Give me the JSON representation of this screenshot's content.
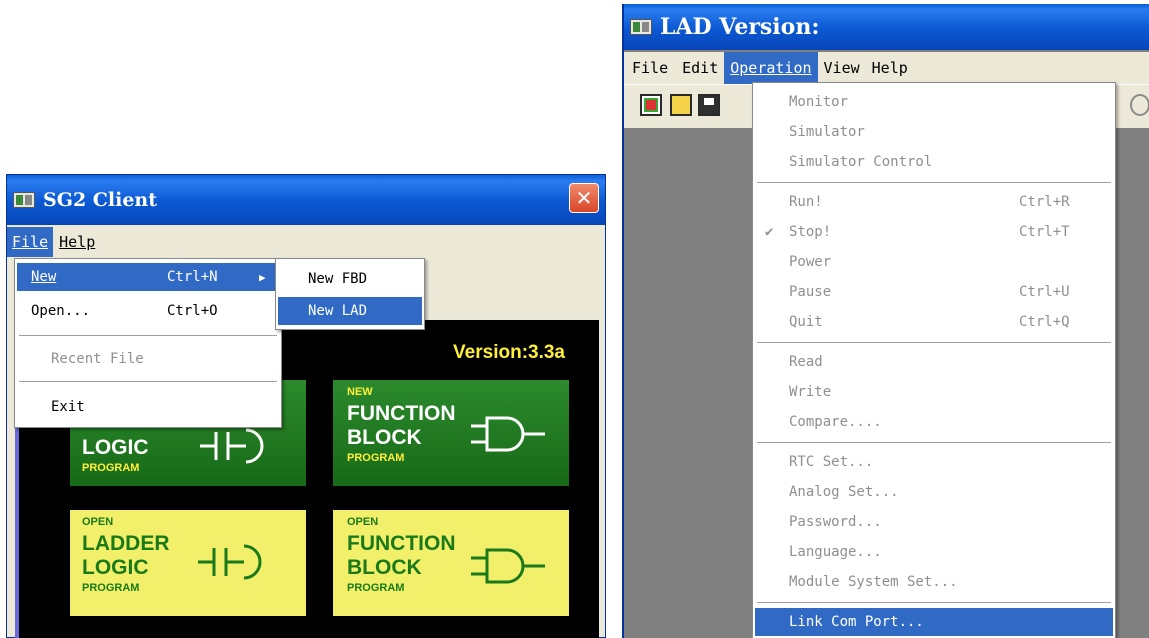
{
  "left_window": {
    "title": "SG2 Client",
    "menu": [
      {
        "label": "File",
        "key": "F"
      },
      {
        "label": "Help",
        "key": "H"
      }
    ],
    "file_menu": [
      {
        "label": "New",
        "shortcut": "Ctrl+N",
        "submenu": true,
        "state": "highlighted"
      },
      {
        "label": "Open...",
        "shortcut": "Ctrl+O",
        "state": "enabled"
      },
      {
        "label": "Recent File",
        "shortcut": "",
        "state": "disabled"
      },
      {
        "label": "Exit",
        "shortcut": "",
        "state": "enabled"
      }
    ],
    "new_submenu": [
      {
        "label": "New FBD",
        "state": "enabled"
      },
      {
        "label": "New LAD",
        "state": "highlighted"
      }
    ],
    "version": "Version:3.3a",
    "tiles": {
      "new_ladder": {
        "big": [
          "LOGIC"
        ],
        "small": "PROGRAM"
      },
      "new_fbd": {
        "top": "NEW",
        "big": [
          "FUNCTION",
          "BLOCK"
        ],
        "small": "PROGRAM"
      },
      "open_ladder": {
        "top": "OPEN",
        "big": [
          "LADDER",
          "LOGIC"
        ],
        "small": "PROGRAM"
      },
      "open_fbd": {
        "top": "OPEN",
        "big": [
          "FUNCTION",
          "BLOCK"
        ],
        "small": "PROGRAM"
      }
    }
  },
  "right_window": {
    "title": "LAD Version:",
    "menu": [
      {
        "label": "File",
        "key": "F",
        "state": "normal"
      },
      {
        "label": "Edit",
        "key": "E",
        "state": "normal"
      },
      {
        "label": "Operation",
        "key": "O",
        "state": "open"
      },
      {
        "label": "View",
        "key": "V",
        "state": "normal"
      },
      {
        "label": "Help",
        "key": "H",
        "state": "normal"
      }
    ],
    "toolbar_icons": [
      "new-icon",
      "open-folder-icon",
      "save-icon"
    ],
    "operation_menu": [
      {
        "label": "Monitor",
        "shortcut": "",
        "state": "disabled",
        "checked": false
      },
      {
        "label": "Simulator",
        "shortcut": "",
        "state": "disabled",
        "checked": false
      },
      {
        "label": "Simulator Control",
        "shortcut": "",
        "state": "disabled",
        "checked": false
      },
      {
        "label": "Run!",
        "shortcut": "Ctrl+R",
        "state": "disabled",
        "checked": false
      },
      {
        "label": "Stop!",
        "shortcut": "Ctrl+T",
        "state": "disabled",
        "checked": true
      },
      {
        "label": "Power",
        "shortcut": "",
        "state": "disabled",
        "checked": false
      },
      {
        "label": "Pause",
        "shortcut": "Ctrl+U",
        "state": "disabled",
        "checked": false
      },
      {
        "label": "Quit",
        "shortcut": "Ctrl+Q",
        "state": "disabled",
        "checked": false
      },
      {
        "label": "Read",
        "shortcut": "",
        "state": "disabled",
        "checked": false
      },
      {
        "label": "Write",
        "shortcut": "",
        "state": "disabled",
        "checked": false
      },
      {
        "label": "Compare....",
        "shortcut": "",
        "state": "disabled",
        "checked": false
      },
      {
        "label": "RTC Set...",
        "shortcut": "",
        "state": "disabled",
        "checked": false
      },
      {
        "label": "Analog Set...",
        "shortcut": "",
        "state": "disabled",
        "checked": false
      },
      {
        "label": "Password...",
        "shortcut": "",
        "state": "disabled",
        "checked": false
      },
      {
        "label": "Language...",
        "shortcut": "",
        "state": "disabled",
        "checked": false
      },
      {
        "label": "Module System Set...",
        "shortcut": "",
        "state": "disabled",
        "checked": false
      },
      {
        "label": "Link Com Port...",
        "shortcut": "",
        "state": "highlighted",
        "checked": false
      }
    ]
  },
  "colors": {
    "title_blue": "#0b58d2",
    "menu_highlight": "#316ac5",
    "green_tile": "#1f7a1f",
    "yellow_tile": "#f2ef6a",
    "version_text": "#ffef3a",
    "disabled_text": "#8f8f8f"
  }
}
